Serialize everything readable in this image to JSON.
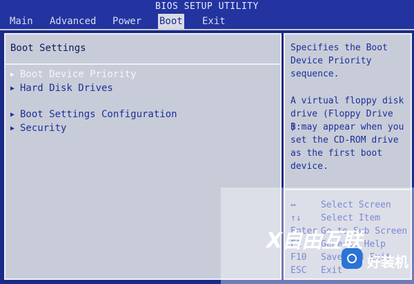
{
  "title": "BIOS SETUP UTILITY",
  "menu": {
    "items": [
      "Main",
      "Advanced",
      "Power",
      "Boot",
      "Exit"
    ],
    "active": "Boot"
  },
  "main": {
    "title": "Boot Settings",
    "items": [
      "Boot Device Priority",
      "Hard Disk Drives",
      "Boot Settings Configuration",
      "Security"
    ]
  },
  "help": {
    "line1": "Specifies the Boot",
    "line2": "Device Priority",
    "line3": "sequence.",
    "line4": "A virtual floppy disk",
    "line5": "drive (Floppy Drive B:",
    "line6": ") may appear when you",
    "line7": "set the CD-ROM drive",
    "line8": "as the first boot",
    "line9": "device."
  },
  "keys": [
    {
      "key": "↔",
      "action": "Select Screen"
    },
    {
      "key": "↑↓",
      "action": "Select Item"
    },
    {
      "key": "Enter",
      "action": "Go to Sub Screen"
    },
    {
      "key": "F1",
      "action": "General Help"
    },
    {
      "key": "F10",
      "action": "Save and Exit"
    },
    {
      "key": "ESC",
      "action": "Exit"
    }
  ],
  "watermark": {
    "logo": "X自由互联",
    "text": "好装机"
  },
  "colors": {
    "background": "#1a2a86",
    "panel": "#c7ccd8",
    "text": "#1c2f9a",
    "highlight": "#f4f6ff"
  }
}
